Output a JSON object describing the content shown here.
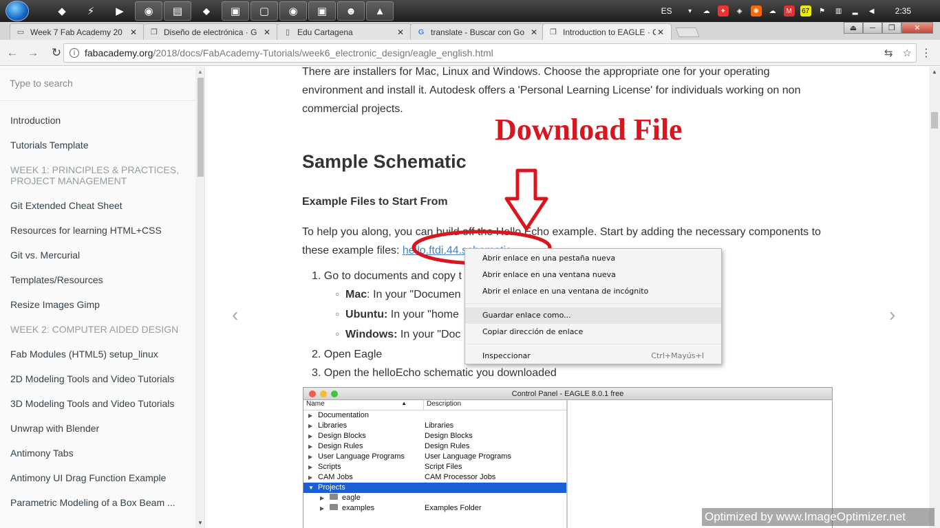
{
  "taskbar": {
    "language": "ES",
    "time": "2:35",
    "pinned_icons": [
      "app-icon",
      "winamp-icon",
      "media-player-icon",
      "chrome-icon",
      "explorer-icon",
      "app-icon",
      "window-icon",
      "window-icon",
      "chrome-icon",
      "window-icon",
      "app-icon",
      "app-icon"
    ],
    "tray_badge": "67",
    "tray_gmail": "M"
  },
  "browser": {
    "tabs": [
      {
        "title": "Week 7 Fab Academy 20",
        "favicon": "document-icon"
      },
      {
        "title": "Diseño de electrónica · G",
        "favicon": "book-icon"
      },
      {
        "title": "Edu Cartagena",
        "favicon": "page-icon"
      },
      {
        "title": "translate - Buscar con Go",
        "favicon": "google-icon"
      },
      {
        "title": "Introduction to EAGLE · C",
        "favicon": "book-icon"
      }
    ],
    "url_host": "fabacademy.org",
    "url_path": "/2018/docs/FabAcademy-Tutorials/week6_electronic_design/eagle_english.html"
  },
  "sidebar": {
    "search_placeholder": "Type to search",
    "items": [
      {
        "type": "link",
        "label": "Introduction"
      },
      {
        "type": "link",
        "label": "Tutorials Template"
      },
      {
        "type": "header",
        "label": "WEEK 1: PRINCIPLES & PRACTICES, PROJECT MANAGEMENT"
      },
      {
        "type": "link",
        "label": "Git Extended Cheat Sheet"
      },
      {
        "type": "link",
        "label": "Resources for learning HTML+CSS"
      },
      {
        "type": "link",
        "label": "Git vs. Mercurial"
      },
      {
        "type": "link",
        "label": "Templates/Resources"
      },
      {
        "type": "link",
        "label": "Resize Images Gimp"
      },
      {
        "type": "header",
        "label": "WEEK 2: COMPUTER AIDED DESIGN"
      },
      {
        "type": "link",
        "label": "Fab Modules (HTML5) setup_linux"
      },
      {
        "type": "link",
        "label": "2D Modeling Tools and Video Tutorials"
      },
      {
        "type": "link",
        "label": "3D Modeling Tools and Video Tutorials"
      },
      {
        "type": "link",
        "label": "Unwrap with Blender"
      },
      {
        "type": "link",
        "label": "Antimony Tabs"
      },
      {
        "type": "link",
        "label": "Antimony UI Drag Function Example"
      },
      {
        "type": "link",
        "label": "Parametric Modeling of a Box Beam ..."
      }
    ]
  },
  "content": {
    "intro": "There are installers for Mac, Linux and Windows. Choose the appropriate one for your operating environment and install it. Autodesk offers a 'Personal Learning License' for individuals working on non commercial projects.",
    "h2": "Sample Schematic",
    "h3": "Example Files to Start From",
    "help_prefix": "To help you along, you can build off the Hello Echo example. Start by adding the necessary components to these example files: ",
    "help_link": "hello.ftdi.44.schematic",
    "steps": {
      "s1": "1. Go to documents and copy t",
      "mac_b": "Mac",
      "mac_t": ": In your \"Documen",
      "ubu_b": "Ubuntu:",
      "ubu_t": " In your \"home",
      "win_b": "Windows:",
      "win_t": " In your \"Doc",
      "s2": "2. Open Eagle",
      "s3": "3. Open the helloEcho schematic you downloaded"
    },
    "annotation": "Download File"
  },
  "eagle": {
    "title": "Control Panel - EAGLE 8.0.1 free",
    "col_name": "Name",
    "col_desc": "Description",
    "rows": [
      {
        "name": "Documentation",
        "desc": "",
        "tri": "▶"
      },
      {
        "name": "Libraries",
        "desc": "Libraries",
        "tri": "▶"
      },
      {
        "name": "Design Blocks",
        "desc": "Design Blocks",
        "tri": "▶"
      },
      {
        "name": "Design Rules",
        "desc": "Design Rules",
        "tri": "▶"
      },
      {
        "name": "User Language Programs",
        "desc": "User Language Programs",
        "tri": "▶"
      },
      {
        "name": "Scripts",
        "desc": "Script Files",
        "tri": "▶"
      },
      {
        "name": "CAM Jobs",
        "desc": "CAM Processor Jobs",
        "tri": "▶"
      },
      {
        "name": "Projects",
        "desc": "",
        "tri": "▼"
      },
      {
        "name": "eagle",
        "desc": "",
        "tri": "▶"
      },
      {
        "name": "examples",
        "desc": "Examples Folder",
        "tri": "▶"
      }
    ]
  },
  "context_menu": {
    "items": [
      "Abrir enlace en una pestaña nueva",
      "Abrir enlace en una ventana nueva",
      "Abrir el enlace en una ventana de incógnito",
      "Guardar enlace como...",
      "Copiar dirección de enlace",
      "Inspeccionar"
    ],
    "inspect_shortcut": "Ctrl+Mayús+I"
  },
  "watermark": "Optimized by www.ImageOptimizer.net",
  "colors": {
    "accent_red": "#d9151d",
    "link": "#4183c4",
    "selection": "#1a5fd6"
  }
}
